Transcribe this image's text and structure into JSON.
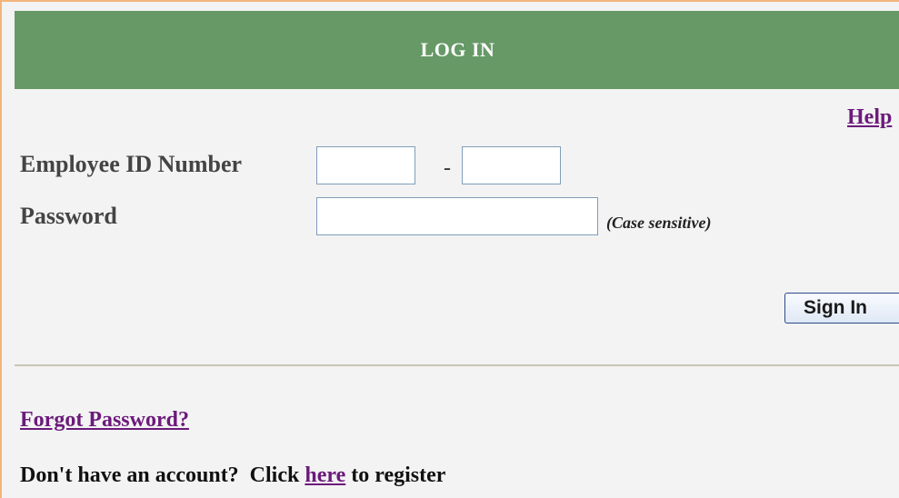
{
  "header": {
    "title": "LOG IN"
  },
  "help_link": "Help",
  "form": {
    "employee_id_label": "Employee ID Number",
    "employee_id_part1_value": "",
    "employee_id_separator": "-",
    "employee_id_part2_value": "",
    "password_label": "Password",
    "password_value": "",
    "password_hint": "(Case sensitive)",
    "sign_in_label": "Sign In"
  },
  "footer": {
    "forgot_password": "Forgot Password?",
    "register_prefix": "Don't have an account?  Click ",
    "register_link": "here",
    "register_suffix": " to register"
  },
  "colors": {
    "header_bg": "#669966",
    "panel_bg": "#f3f3f3",
    "link": "#6b1a7a",
    "outer_border": "#f2b57a"
  }
}
